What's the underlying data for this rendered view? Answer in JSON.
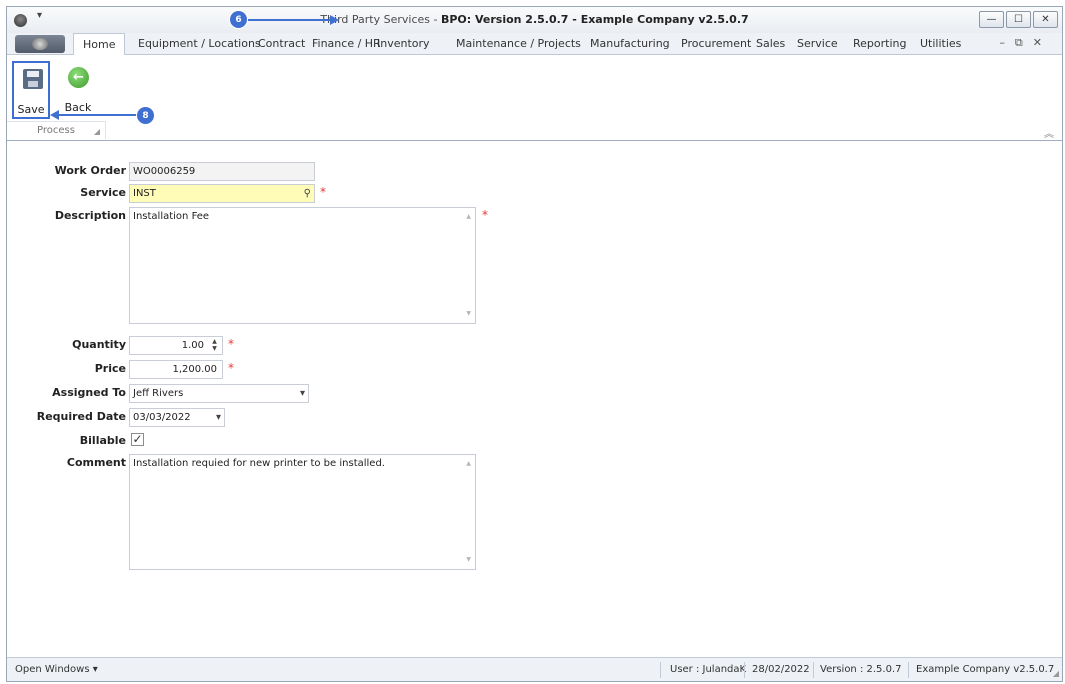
{
  "window": {
    "title_prefix": "Third Party Services - ",
    "title_main": "BPO: Version 2.5.0.7 - Example Company v2.5.0.7",
    "quick_access": "▾",
    "controls": [
      "—",
      "☐",
      "✕"
    ]
  },
  "ribbon": {
    "tabs": [
      "Home",
      "Equipment / Locations",
      "Contract",
      "Finance / HR",
      "Inventory",
      "Maintenance / Projects",
      "Manufacturing",
      "Procurement",
      "Sales",
      "Service",
      "Reporting",
      "Utilities"
    ],
    "mdi_controls": "–⧉✕",
    "buttons": {
      "save": "Save",
      "back": "Back"
    },
    "group": "Process"
  },
  "form": {
    "labels": {
      "work_order": "Work Order",
      "service": "Service",
      "description": "Description",
      "quantity": "Quantity",
      "price": "Price",
      "assigned_to": "Assigned To",
      "required_date": "Required Date",
      "billable": "Billable",
      "comment": "Comment"
    },
    "values": {
      "work_order": "WO0006259",
      "service": "INST",
      "description": "Installation Fee",
      "quantity": "1.00",
      "price": "1,200.00",
      "assigned_to": "Jeff Rivers",
      "required_date": "03/03/2022",
      "billable": true,
      "comment": "Installation requied for new printer to be installed."
    },
    "required_mark": "*"
  },
  "statusbar": {
    "open_windows": "Open Windows ▾",
    "user": "User : JulandaK",
    "date": "28/02/2022",
    "version": "Version : 2.5.0.7",
    "company": "Example Company v2.5.0.7"
  },
  "annotations": {
    "title_step": "6",
    "save_step": "8"
  },
  "colors": {
    "accent": "#3f6fd1",
    "required_bg": "#fffcb8",
    "required_mark": "#e53935"
  },
  "icons": {
    "save": "save-icon",
    "back": "back-arrow-icon",
    "search": "search-icon"
  }
}
